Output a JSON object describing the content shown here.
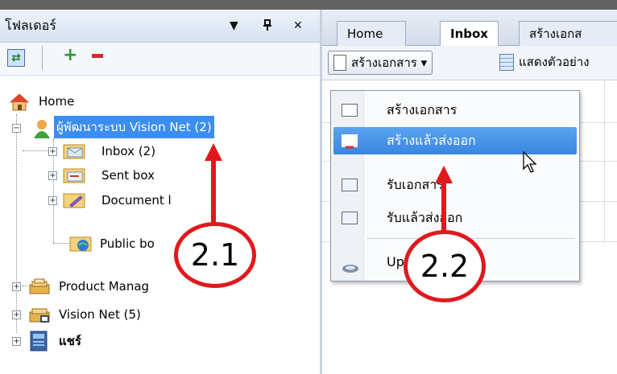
{
  "left_panel": {
    "title": "โฟลเดอร์",
    "controls": [
      "▼",
      "ᵖ",
      "✕"
    ],
    "tree": {
      "home": "Home",
      "user": "ผู้พัฒนาระบบ Vision Net (2)",
      "inbox": "Inbox (2)",
      "sent": "Sent box",
      "document": "Document l",
      "public": "Public bo",
      "product": "Product Manag",
      "vision": "Vision Net (5)",
      "share": "แชร์"
    }
  },
  "right_panel": {
    "tabs": [
      "Home",
      "Inbox",
      "สร้างเอกส"
    ],
    "new_document_button": "สร้างเอกสาร ▾",
    "preview_button": "แสดงตัวอย่าง"
  },
  "menu": {
    "items": [
      {
        "label": "สร้างเอกสาร",
        "icon": "new-doc-icon"
      },
      {
        "label": "สร้างแล้วส่งออก",
        "icon": "new-send-icon"
      },
      {
        "label": "รับเอกสาร",
        "icon": "receive-doc-icon"
      },
      {
        "label": "รับแล้วส่งออก",
        "icon": "receive-send-icon"
      },
      {
        "label": "Up item",
        "icon": "upload-icon"
      }
    ]
  },
  "annotations": {
    "step1": "2.1",
    "step2": "2.2"
  },
  "colors": {
    "selection": "#3b8ef0",
    "annotation": "#e0191d",
    "menu_highlight": "#3a86df"
  }
}
